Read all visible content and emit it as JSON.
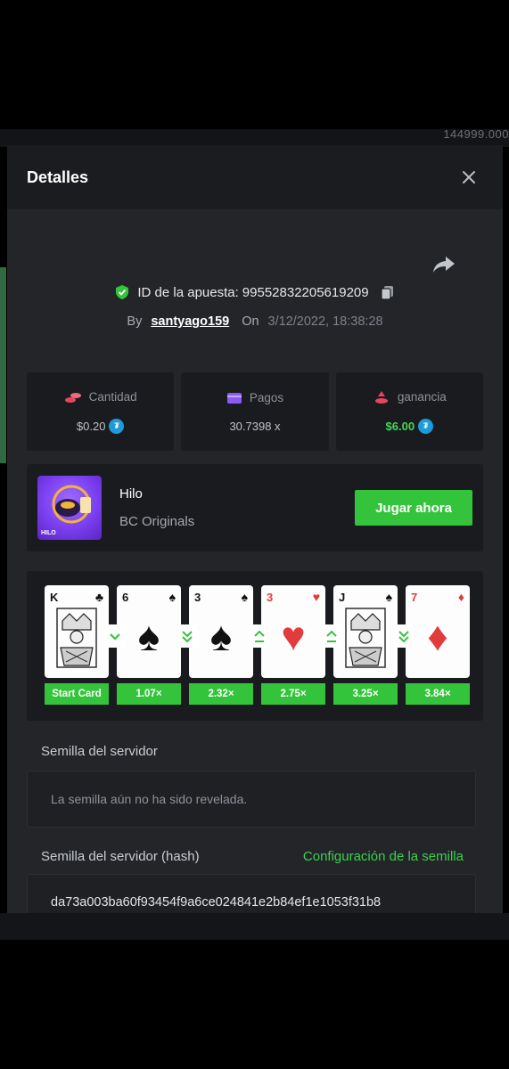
{
  "background": {
    "balance_text": "144999.000"
  },
  "modal": {
    "title": "Detalles",
    "bet_id_label": "ID de la apuesta:",
    "bet_id_value": "99552832205619209",
    "by_label": "By",
    "username": "santyago159",
    "on_label": "On",
    "date": "3/12/2022, 18:38:28"
  },
  "stats": {
    "amount": {
      "label": "Cantidad",
      "value": "$0.20",
      "icon": "coins-icon"
    },
    "payout": {
      "label": "Pagos",
      "value": "30.7398 x",
      "icon": "wallet-icon"
    },
    "profit": {
      "label": "ganancia",
      "value": "$6.00",
      "icon": "coins-profit-icon"
    }
  },
  "game": {
    "name": "Hilo",
    "provider": "BC Originals",
    "thumb_label": "HILO",
    "play_label": "Jugar ahora"
  },
  "cards": [
    {
      "rank": "K",
      "suit": "♣",
      "color": "#111",
      "face": true,
      "multiplier": "Start Card"
    },
    {
      "rank": "6",
      "suit": "♠",
      "color": "#111",
      "face": false,
      "multiplier": "1.07×"
    },
    {
      "rank": "3",
      "suit": "♠",
      "color": "#111",
      "face": false,
      "multiplier": "2.32×"
    },
    {
      "rank": "3",
      "suit": "♥",
      "color": "#e23b3b",
      "face": false,
      "multiplier": "2.75×"
    },
    {
      "rank": "J",
      "suit": "♠",
      "color": "#111",
      "face": true,
      "multiplier": "3.25×"
    },
    {
      "rank": "7",
      "suit": "♦",
      "color": "#e23b3b",
      "face": false,
      "multiplier": "3.84×"
    }
  ],
  "arrows": [
    "down",
    "down-double",
    "up-double",
    "up-double",
    "down-double"
  ],
  "seed": {
    "server_seed_label": "Semilla del servidor",
    "server_seed_value": "La semilla aún no ha sido revelada.",
    "hash_label": "Semilla del servidor (hash)",
    "config_link": "Configuración de la semilla",
    "hash_value": "da73a003ba60f93454f9a6ce024841e2b84ef1e1053f31b8"
  },
  "colors": {
    "accent_green": "#34c43b",
    "win_green": "#42d85a",
    "coin_blue": "#1e9ad8"
  }
}
